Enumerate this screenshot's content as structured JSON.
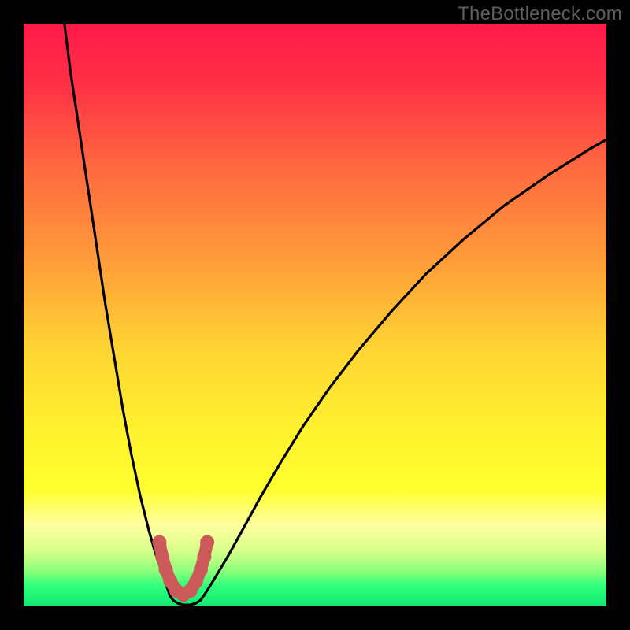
{
  "watermark": "TheBottleneck.com",
  "chart_data": {
    "type": "line",
    "title": "",
    "xlabel": "",
    "ylabel": "",
    "xlim": [
      0,
      100
    ],
    "ylim": [
      0,
      100
    ],
    "background_gradient": {
      "stops": [
        {
          "pos": 0.0,
          "color": "#ff1a49"
        },
        {
          "pos": 0.1,
          "color": "#ff2f46"
        },
        {
          "pos": 0.25,
          "color": "#ff6a3f"
        },
        {
          "pos": 0.4,
          "color": "#ff9a3a"
        },
        {
          "pos": 0.55,
          "color": "#ffd233"
        },
        {
          "pos": 0.7,
          "color": "#fff22e"
        },
        {
          "pos": 0.8,
          "color": "#ffff2e"
        },
        {
          "pos": 0.86,
          "color": "#ffffa0"
        },
        {
          "pos": 0.905,
          "color": "#d8ff8a"
        },
        {
          "pos": 0.94,
          "color": "#8aff7a"
        },
        {
          "pos": 0.965,
          "color": "#2fff7c"
        },
        {
          "pos": 1.0,
          "color": "#11e871"
        }
      ]
    },
    "series": [
      {
        "name": "left-branch",
        "x": [
          7.0,
          8.0,
          9.5,
          11.0,
          12.5,
          14.0,
          15.5,
          17.0,
          18.5,
          20.0,
          21.5,
          22.5,
          23.5,
          24.3,
          24.8,
          25.1
        ],
        "y": [
          100,
          92,
          82,
          72,
          62,
          52,
          43,
          34,
          26,
          19,
          13,
          9.5,
          6.5,
          4.2,
          2.7,
          1.8
        ]
      },
      {
        "name": "trough",
        "x": [
          25.1,
          25.7,
          26.5,
          27.5,
          28.5,
          29.5,
          30.3,
          30.9
        ],
        "y": [
          1.8,
          1.0,
          0.5,
          0.25,
          0.25,
          0.5,
          1.0,
          1.8
        ]
      },
      {
        "name": "right-branch",
        "x": [
          30.9,
          31.8,
          33.2,
          35.0,
          37.5,
          40.5,
          44.0,
          48.0,
          52.5,
          57.5,
          63.0,
          69.0,
          75.5,
          82.5,
          90.0,
          97.5,
          100.0
        ],
        "y": [
          1.8,
          3.2,
          5.5,
          8.5,
          13.0,
          18.5,
          24.5,
          31.0,
          37.5,
          44.0,
          50.5,
          57.0,
          63.0,
          68.8,
          74.0,
          78.7,
          80.1
        ]
      }
    ],
    "trough_marker": {
      "name": "bottleneck-marker",
      "color": "#cc5a5a",
      "points_x": [
        23.3,
        23.8,
        24.4,
        25.2,
        26.2,
        27.4,
        28.6,
        29.6,
        30.4,
        31.0,
        31.5
      ],
      "points_y": [
        11.0,
        8.5,
        6.3,
        4.3,
        2.7,
        2.0,
        2.7,
        4.3,
        6.3,
        8.5,
        11.0
      ]
    }
  }
}
